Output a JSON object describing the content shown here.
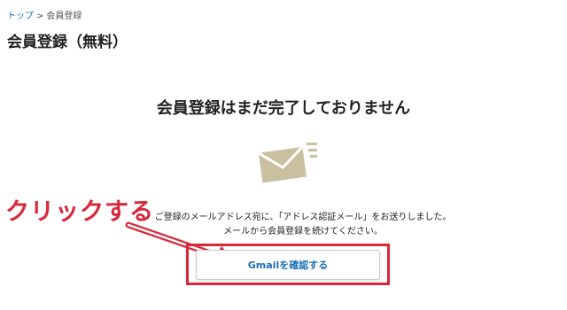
{
  "breadcrumb": {
    "home_label": "トップ",
    "separator": ">",
    "current_label": "会員登録"
  },
  "page_title": "会員登録（無料）",
  "main_heading": "会員登録はまだ完了しておりません",
  "message": {
    "line1": "ご登録のメールアドレス宛に、「アドレス認証メール」をお送りしました。",
    "line2": "メールから会員登録を続けてください。"
  },
  "annotation": {
    "text": "クリックする",
    "color": "#d8283a"
  },
  "confirm_button": {
    "label": "Gmailを確認する"
  },
  "icons": {
    "mail": "mail-envelope-icon"
  },
  "colors": {
    "link": "#1a6fb5",
    "annotation_red": "#d8283a",
    "envelope": "#c9c0a0"
  }
}
